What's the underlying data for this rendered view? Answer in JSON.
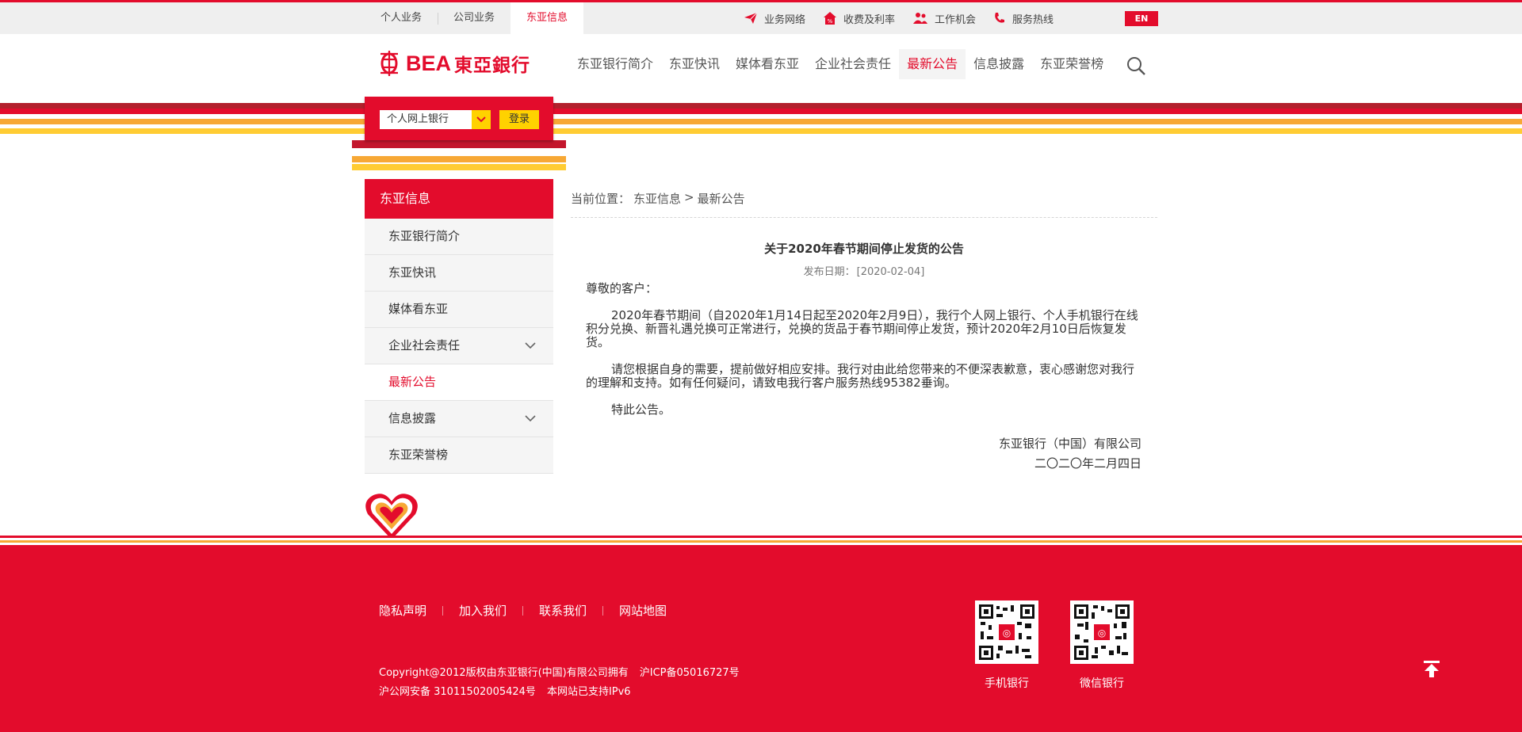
{
  "top_bar": {
    "tabs": [
      "个人业务",
      "公司业务",
      "东亚信息"
    ],
    "active_tab": "东亚信息",
    "links": [
      {
        "label": "业务网络",
        "icon": "paper-plane-icon"
      },
      {
        "label": "收费及利率",
        "icon": "fee-rate-icon"
      },
      {
        "label": "工作机会",
        "icon": "people-icon"
      },
      {
        "label": "服务热线",
        "icon": "phone-icon"
      }
    ],
    "lang_button": "EN"
  },
  "header": {
    "logo_text": "BEA",
    "logo_cn": "東亞銀行",
    "nav": [
      "东亚银行简介",
      "东亚快讯",
      "媒体看东亚",
      "企业社会责任",
      "最新公告",
      "信息披露",
      "东亚荣誉榜"
    ],
    "active_nav": "最新公告"
  },
  "login": {
    "select_value": "个人网上银行",
    "button": "登录"
  },
  "sidebar": {
    "title": "东亚信息",
    "items": [
      {
        "label": "东亚银行简介",
        "expandable": false,
        "active": false
      },
      {
        "label": "东亚快讯",
        "expandable": false,
        "active": false
      },
      {
        "label": "媒体看东亚",
        "expandable": false,
        "active": false
      },
      {
        "label": "企业社会责任",
        "expandable": true,
        "active": false
      },
      {
        "label": "最新公告",
        "expandable": false,
        "active": true
      },
      {
        "label": "信息披露",
        "expandable": true,
        "active": false
      },
      {
        "label": "东亚荣誉榜",
        "expandable": false,
        "active": false
      }
    ]
  },
  "breadcrumb": {
    "prefix": "当前位置：",
    "items": [
      "东亚信息",
      "最新公告"
    ],
    "separator": ">"
  },
  "article": {
    "title": "关于2020年春节期间停止发货的公告",
    "date_label": "发布日期：",
    "date_value": "[2020-02-04]",
    "greeting": "尊敬的客户：",
    "paragraphs": [
      "2020年春节期间（自2020年1月14日起至2020年2月9日），我行个人网上银行、个人手机银行在线积分兑换、新晋礼遇兑换可正常进行，兑换的货品于春节期间停止发货，预计2020年2月10日后恢复发货。",
      "请您根据自身的需要，提前做好相应安排。我行对由此给您带来的不便深表歉意，衷心感谢您对我行的理解和支持。如有任何疑问，请致电我行客户服务热线95382垂询。",
      "特此公告。"
    ],
    "signature_org": "东亚银行（中国）有限公司",
    "signature_date": "二〇二〇年二月四日"
  },
  "footer": {
    "links": [
      "隐私声明",
      "加入我们",
      "联系我们",
      "网站地图"
    ],
    "copyright_line1": "Copyright@2012版权由东亚银行(中国)有限公司拥有",
    "icp": "沪ICP备05016727号",
    "police": "沪公网安备 31011502005424号",
    "ipv6": "本网站已支持IPv6",
    "qr_codes": [
      {
        "label": "手机银行"
      },
      {
        "label": "微信银行"
      }
    ]
  },
  "colors": {
    "brand_red": "#e30c2c",
    "yellow": "#ffd200",
    "orange": "#f7a835",
    "dark_red": "#b3202c"
  }
}
